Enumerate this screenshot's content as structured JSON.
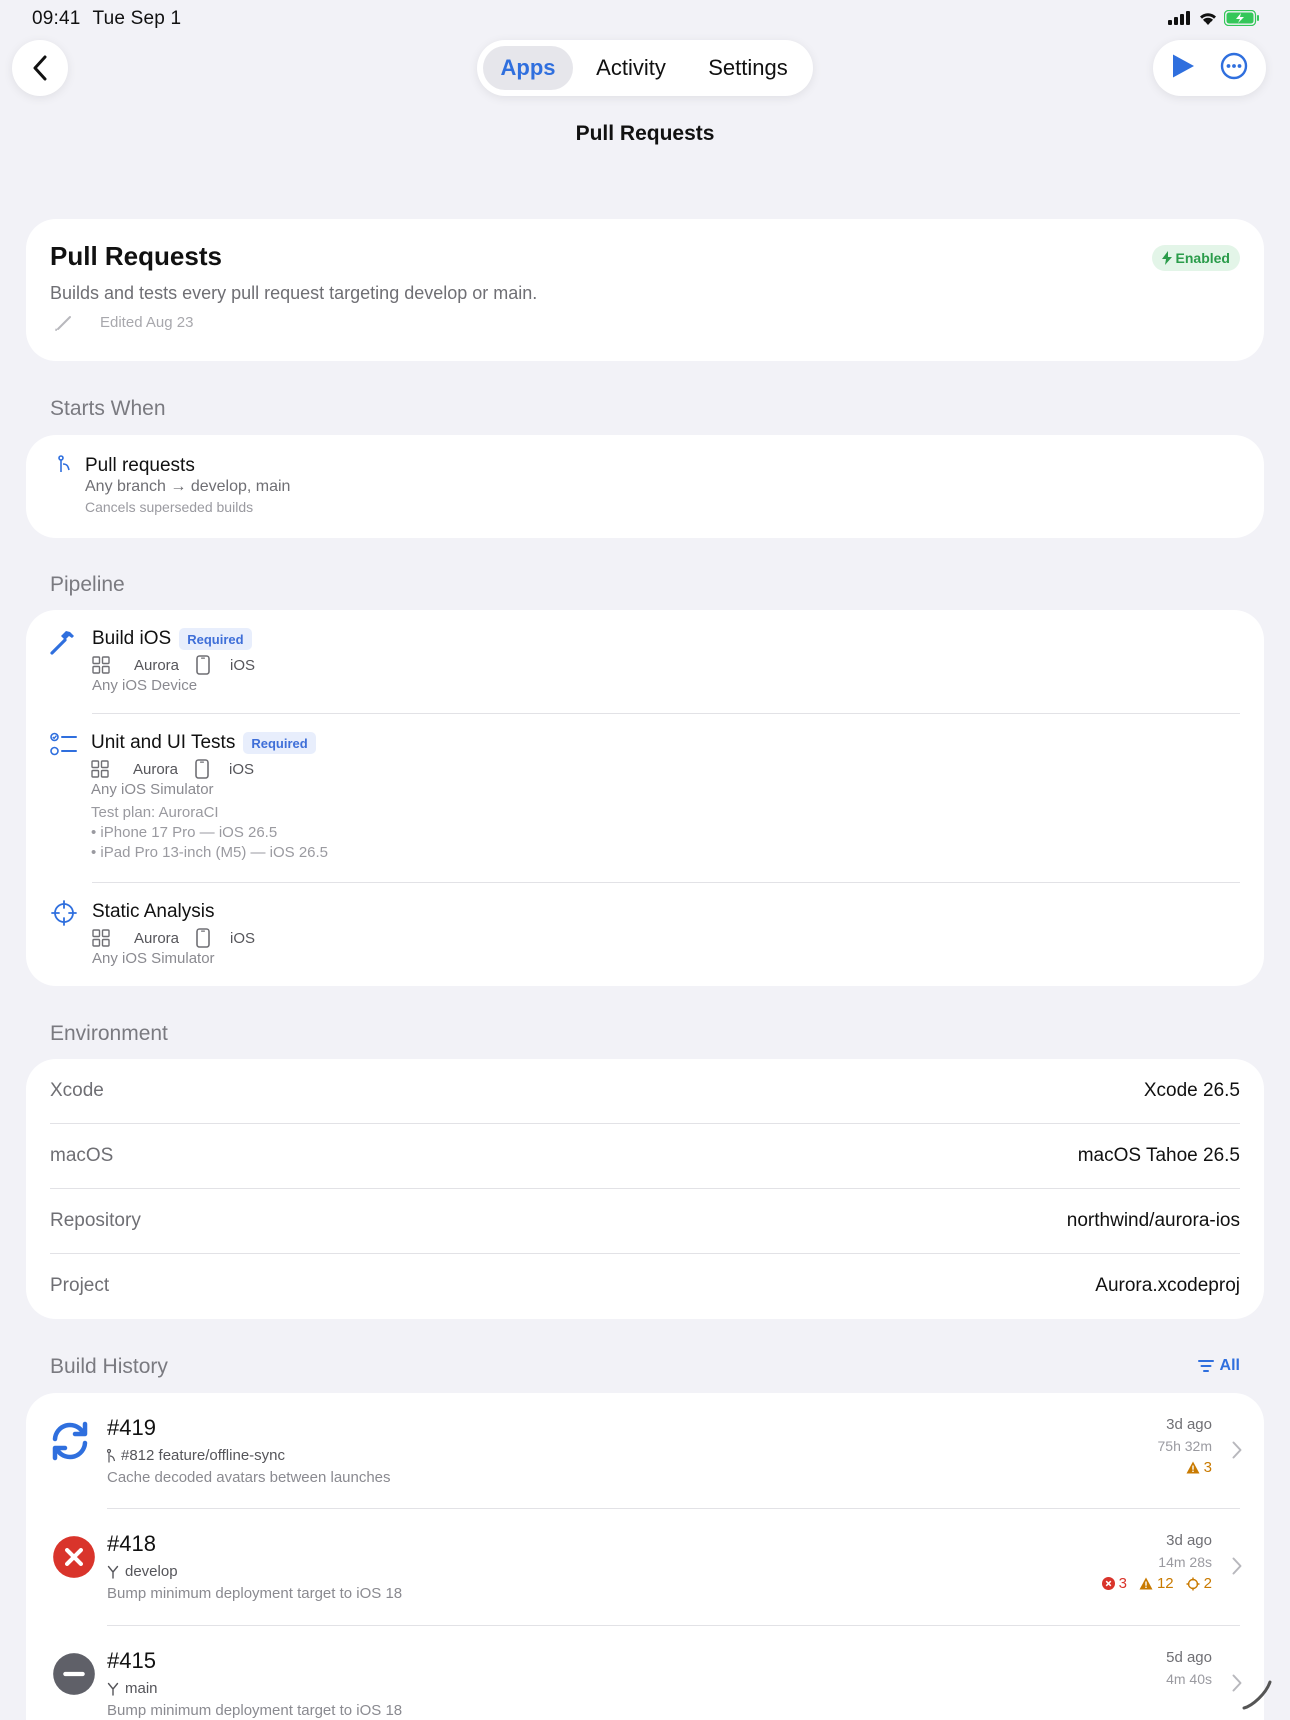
{
  "status": {
    "time": "09:41",
    "date": "Tue Sep 1"
  },
  "nav": {
    "tabs": [
      {
        "label": "Apps",
        "active": true
      },
      {
        "label": "Activity",
        "active": false
      },
      {
        "label": "Settings",
        "active": false
      }
    ],
    "title": "Pull Requests"
  },
  "workflow": {
    "name": "Pull Requests",
    "status": "Enabled",
    "description": "Builds and tests every pull request targeting develop or main.",
    "edited": "Edited Aug 23"
  },
  "starts_when": {
    "section": "Starts When",
    "title": "Pull requests",
    "branches": "Any branch → develop, main",
    "note": "Cancels superseded builds"
  },
  "pipeline": {
    "section": "Pipeline",
    "actions": [
      {
        "name": "Build iOS",
        "required": "Required",
        "scheme": "Aurora",
        "platform": "iOS",
        "destination": "Any iOS Device"
      },
      {
        "name": "Unit and UI Tests",
        "required": "Required",
        "scheme": "Aurora",
        "platform": "iOS",
        "destination": "Any iOS Simulator",
        "test_plan": "Test plan: AuroraCI",
        "devices": [
          "• iPhone 17 Pro — iOS 26.5",
          "• iPad Pro 13-inch (M5) — iOS 26.5"
        ]
      },
      {
        "name": "Static Analysis",
        "scheme": "Aurora",
        "platform": "iOS",
        "destination": "Any iOS Simulator"
      }
    ]
  },
  "environment": {
    "section": "Environment",
    "rows": [
      {
        "key": "Xcode",
        "value": "Xcode 26.5"
      },
      {
        "key": "macOS",
        "value": "macOS Tahoe 26.5"
      },
      {
        "key": "Repository",
        "value": "northwind/aurora-ios"
      },
      {
        "key": "Project",
        "value": "Aurora.xcodeproj"
      }
    ]
  },
  "history": {
    "section": "Build History",
    "filter": "All",
    "builds": [
      {
        "number": "#419",
        "status": "running",
        "ref": "#812 feature/offline-sync",
        "message": "Cache decoded avatars between launches",
        "when": "3d ago",
        "duration": "75h 32m",
        "warnings": "3"
      },
      {
        "number": "#418",
        "status": "failed",
        "ref": "develop",
        "message": "Bump minimum deployment target to iOS 18",
        "when": "3d ago",
        "duration": "14m 28s",
        "errors": "3",
        "warnings": "12",
        "analyzer": "2"
      },
      {
        "number": "#415",
        "status": "canceled",
        "ref": "main",
        "message": "Bump minimum deployment target to iOS 18",
        "when": "5d ago",
        "duration": "4m 40s"
      }
    ]
  },
  "colors": {
    "accent": "#2f6fde",
    "error": "#d9342b",
    "warning": "#c97a00",
    "success": "#2a9c4a",
    "canceled": "#5f6068"
  },
  "icons": [
    "back-chevron-icon",
    "play-icon",
    "more-icon",
    "bolt-icon",
    "pencil-icon",
    "pull-request-icon",
    "hammer-icon",
    "tests-icon",
    "crosshair-icon",
    "scheme-icon",
    "device-icon",
    "filter-icon",
    "running-icon",
    "error-icon",
    "canceled-icon",
    "branch-icon",
    "warning-icon",
    "chevron-right-icon"
  ]
}
